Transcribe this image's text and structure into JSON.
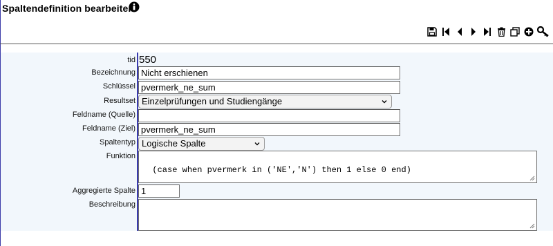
{
  "page": {
    "title": "Spaltendefinition bearbeiten."
  },
  "toolbar": {
    "buttons": [
      {
        "name": "save-button",
        "icon": "save-icon",
        "title": "Speichern"
      },
      {
        "name": "first-button",
        "icon": "first-record-icon",
        "title": "Erster"
      },
      {
        "name": "previous-button",
        "icon": "previous-record-icon",
        "title": "Vorheriger"
      },
      {
        "name": "next-button",
        "icon": "next-record-icon",
        "title": "Nächster"
      },
      {
        "name": "last-button",
        "icon": "last-record-icon",
        "title": "Letzter"
      },
      {
        "name": "delete-button",
        "icon": "trash-icon",
        "title": "Löschen"
      },
      {
        "name": "copy-button",
        "icon": "copy-icon",
        "title": "Kopieren"
      },
      {
        "name": "add-button",
        "icon": "plus-circle-icon",
        "title": "Neu"
      },
      {
        "name": "key-button",
        "icon": "key-icon",
        "title": "Schlüssel"
      }
    ]
  },
  "form": {
    "tid": {
      "label": "tid",
      "value": "550"
    },
    "bezeichnung": {
      "label": "Bezeichnung",
      "value": "Nicht erschienen"
    },
    "schluessel": {
      "label": "Schlüssel",
      "value": "pvermerk_ne_sum"
    },
    "resultset": {
      "label": "Resultset",
      "value": "Einzelprüfungen und Studiengänge"
    },
    "feldname_quelle": {
      "label": "Feldname (Quelle)",
      "value": ""
    },
    "feldname_ziel": {
      "label": "Feldname (Ziel)",
      "value": "pvermerk_ne_sum"
    },
    "spaltentyp": {
      "label": "Spaltentyp",
      "value": "Logische Spalte"
    },
    "funktion": {
      "label": "Funktion",
      "value": "(case when pvermerk in ('NE','N') then 1 else 0 end)"
    },
    "aggregierte_spalte": {
      "label": "Aggregierte Spalte",
      "value": "1"
    },
    "beschreibung": {
      "label": "Beschreibung",
      "value": ""
    }
  },
  "colors": {
    "form_background": "#f2f7fc",
    "divider": "#3a3ab0",
    "border": "#6f6f6f"
  }
}
